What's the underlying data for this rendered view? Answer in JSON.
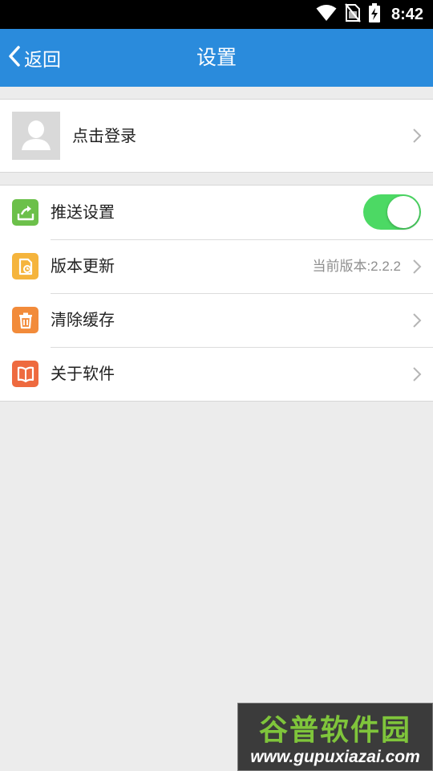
{
  "status_bar": {
    "time": "8:42",
    "icons": [
      "wifi-icon",
      "no-sim-icon",
      "battery-charging-icon"
    ]
  },
  "header": {
    "back_label": "返回",
    "title": "设置",
    "color": "#2a8bdc"
  },
  "account": {
    "login_label": "点击登录",
    "avatar_icon": "user-placeholder-icon"
  },
  "settings": {
    "items": [
      {
        "label": "推送设置",
        "icon": "upload-tray-icon",
        "icon_color": "#6cc04a",
        "toggle_on": true,
        "toggle_color": "#4cd964"
      },
      {
        "label": "版本更新",
        "icon": "document-update-icon",
        "icon_color": "#f5b43c",
        "value": "当前版本:2.2.2"
      },
      {
        "label": "清除缓存",
        "icon": "trash-icon",
        "icon_color": "#f28b3a"
      },
      {
        "label": "关于软件",
        "icon": "book-icon",
        "icon_color": "#ee6a3f"
      }
    ]
  },
  "watermark": {
    "brand": "谷普软件园",
    "url": "www.gupuxiazai.com"
  }
}
